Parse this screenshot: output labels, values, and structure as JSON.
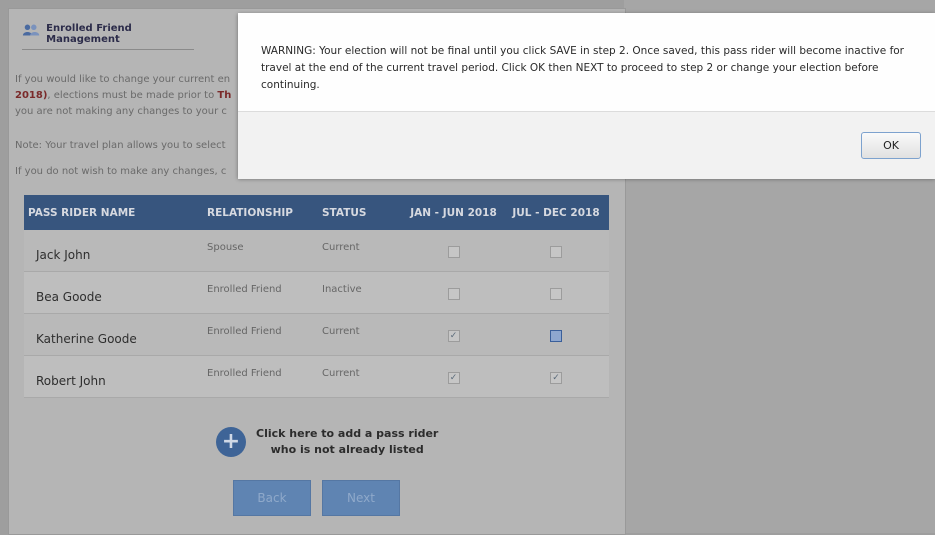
{
  "panel": {
    "title": "Enrolled Friend Management",
    "intro_line1": "If you would like to change your current en",
    "intro_bold": "2018)",
    "intro_line2_rest": ", elections must be made prior to ",
    "intro_bold2": "Th",
    "intro_line3": "you are not making any changes to your c",
    "note": "Note: Your travel plan allows you to select",
    "no_change": "If you do not wish to make any changes, c"
  },
  "table": {
    "headers": [
      "PASS RIDER NAME",
      "RELATIONSHIP",
      "STATUS",
      "JAN - JUN 2018",
      "JUL - DEC 2018"
    ],
    "rows": [
      {
        "name": "Jack John",
        "relationship": "Spouse",
        "status": "Current",
        "jan_checked": "",
        "jul_checked": ""
      },
      {
        "name": "Bea Goode",
        "relationship": "Enrolled Friend",
        "status": "Inactive",
        "jan_checked": "",
        "jul_checked": ""
      },
      {
        "name": "Katherine Goode",
        "relationship": "Enrolled Friend",
        "status": "Current",
        "jan_checked": "✓",
        "jul_checked": ""
      },
      {
        "name": "Robert John",
        "relationship": "Enrolled Friend",
        "status": "Current",
        "jan_checked": "✓",
        "jul_checked": "✓"
      }
    ]
  },
  "add_rider": {
    "line1": "Click here to add a pass rider",
    "line2": "who is not already listed"
  },
  "buttons": {
    "back": "Back",
    "next": "Next"
  },
  "dialog": {
    "message": "WARNING: Your election will not be final until you click SAVE in step 2.  Once saved, this pass rider will become inactive for travel at the end of the current travel period. Click OK then NEXT to proceed to step 2 or change your election before continuing.",
    "ok": "OK"
  }
}
